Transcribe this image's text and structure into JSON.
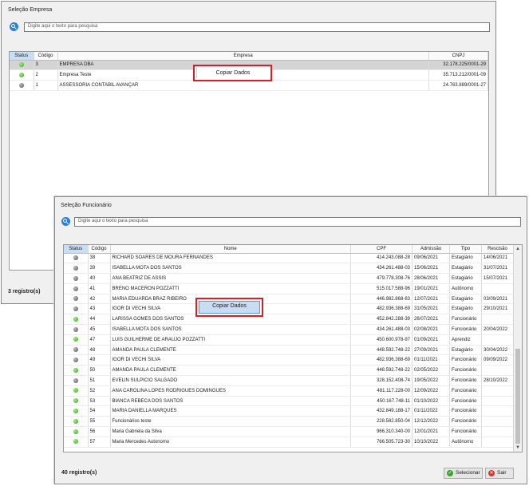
{
  "empresa_window": {
    "title": "Seleção Empresa",
    "search_placeholder": "Digite aqui o texto para pesquisa",
    "columns": {
      "status": "Status",
      "codigo": "Código",
      "empresa": "Empresa",
      "cnpj": "CNPJ"
    },
    "rows": [
      {
        "status": "green",
        "codigo": "3",
        "empresa": "EMPRESA DBA",
        "cnpj": "32.178.225/0001-29"
      },
      {
        "status": "green",
        "codigo": "2",
        "empresa": "Empresa Teste",
        "cnpj": "35.713.212/0001-09"
      },
      {
        "status": "gray",
        "codigo": "1",
        "empresa": "ASSESSORIA CONTABIL AVANÇAR",
        "cnpj": "24.763.889/0001-27"
      }
    ],
    "selected_row": 0,
    "context_menu": {
      "item": "Copiar Dados"
    },
    "count_label": "3 registro(s)"
  },
  "funcionario_window": {
    "title": "Seleção Funcionário",
    "search_placeholder": "Digite aqui o texto para pesquisa",
    "columns": {
      "status": "Status",
      "codigo": "Código",
      "nome": "Nome",
      "cpf": "CPF",
      "admissao": "Admissão",
      "tipo": "Tipo",
      "rescisao": "Rescisão"
    },
    "rows": [
      {
        "status": "gray",
        "codigo": "38",
        "nome": "RICHARD SOARES DE MOURA FERNANDES",
        "cpf": "414.243.088-28",
        "admissao": "09/06/2021",
        "tipo": "Estagiário",
        "rescisao": "14/06/2021"
      },
      {
        "status": "gray",
        "codigo": "39",
        "nome": "ISABELLA MOTA DOS SANTOS",
        "cpf": "434.261.488-03",
        "admissao": "15/06/2021",
        "tipo": "Estagiário",
        "rescisao": "31/07/2021"
      },
      {
        "status": "gray",
        "codigo": "40",
        "nome": "ANA BEATRIZ DE ASSIS",
        "cpf": "479.778.308-76",
        "admissao": "28/06/2021",
        "tipo": "Estagiário",
        "rescisao": "15/07/2021"
      },
      {
        "status": "gray",
        "codigo": "41",
        "nome": "BRENO MACERON POZZATTI",
        "cpf": "515.017.588-96",
        "admissao": "19/01/2021",
        "tipo": "Autônomo",
        "rescisao": ""
      },
      {
        "status": "gray",
        "codigo": "42",
        "nome": "MARIA EDUARDA BRAZ RIBEIRO",
        "cpf": "446.982.868-83",
        "admissao": "12/07/2021",
        "tipo": "Estagiário",
        "rescisao": "03/09/2021"
      },
      {
        "status": "gray",
        "codigo": "43",
        "nome": "IGOR DI VECHI SILVA",
        "cpf": "482.936.388-69",
        "admissao": "31/05/2021",
        "tipo": "Estagiário",
        "rescisao": "29/10/2021"
      },
      {
        "status": "green",
        "codigo": "44",
        "nome": "LARISSA GOMES DOS SANTOS",
        "cpf": "452.842.288-39",
        "admissao": "26/07/2021",
        "tipo": "Funcionário",
        "rescisao": ""
      },
      {
        "status": "gray",
        "codigo": "45",
        "nome": "ISABELLA MOTA DOS SANTOS",
        "cpf": "434.261.488-03",
        "admissao": "02/08/2021",
        "tipo": "Funcionário",
        "rescisao": "20/04/2022"
      },
      {
        "status": "green",
        "codigo": "47",
        "nome": "LUIS GUILHERME DE ARAUJO POZZATTI",
        "cpf": "450.600.978-97",
        "admissao": "01/09/2021",
        "tipo": "Aprendiz",
        "rescisao": ""
      },
      {
        "status": "gray",
        "codigo": "48",
        "nome": "AMANDA PAULA CLEMENTE",
        "cpf": "448.592.748-22",
        "admissao": "27/09/2021",
        "tipo": "Estagiário",
        "rescisao": "30/04/2022"
      },
      {
        "status": "gray",
        "codigo": "49",
        "nome": "IGOR DI VECHI SILVA",
        "cpf": "482.936.388-69",
        "admissao": "01/11/2021",
        "tipo": "Funcionário",
        "rescisao": "09/09/2022"
      },
      {
        "status": "green",
        "codigo": "50",
        "nome": "AMANDA PAULA CLEMENTE",
        "cpf": "448.592.748-22",
        "admissao": "02/05/2022",
        "tipo": "Funcionário",
        "rescisao": ""
      },
      {
        "status": "gray",
        "codigo": "51",
        "nome": "EVELIN SULPICIO SALGADO",
        "cpf": "328.152.408-74",
        "admissao": "19/05/2022",
        "tipo": "Funcionário",
        "rescisao": "28/10/2022"
      },
      {
        "status": "green",
        "codigo": "52",
        "nome": "ANA CAROLINA LOPES RODRIGUES DOMINGUES",
        "cpf": "481.117.228-00",
        "admissao": "12/09/2022",
        "tipo": "Funcionário",
        "rescisao": ""
      },
      {
        "status": "green",
        "codigo": "53",
        "nome": "BIANCA REBECA DOS SANTOS",
        "cpf": "450.167.748-11",
        "admissao": "01/10/2022",
        "tipo": "Funcionário",
        "rescisao": ""
      },
      {
        "status": "green",
        "codigo": "54",
        "nome": "MARIA DANIELLA MARQUES",
        "cpf": "432.849.188-17",
        "admissao": "01/11/2022",
        "tipo": "Funcionário",
        "rescisao": ""
      },
      {
        "status": "green",
        "codigo": "55",
        "nome": "Funcionários teste",
        "cpf": "228.582.850-04",
        "admissao": "12/12/2022",
        "tipo": "Funcionário",
        "rescisao": ""
      },
      {
        "status": "green",
        "codigo": "56",
        "nome": "Maria Gabriela da Silva",
        "cpf": "966.310.340-00",
        "admissao": "12/01/2021",
        "tipo": "Funcionário",
        "rescisao": ""
      },
      {
        "status": "green",
        "codigo": "57",
        "nome": "Maria Mercedes Autonomo",
        "cpf": "766.505.723-30",
        "admissao": "10/10/2022",
        "tipo": "Autônomo",
        "rescisao": ""
      }
    ],
    "context_menu": {
      "item": "Copiar Dados"
    },
    "count_label": "40 registro(s)",
    "buttons": {
      "select": "Selecionar",
      "exit": "Sair"
    }
  },
  "colors": {
    "highlight": "#d81f26",
    "green_status": "#2fa514",
    "gray_status": "#4f4f4f",
    "accent": "#2a7fd8"
  }
}
